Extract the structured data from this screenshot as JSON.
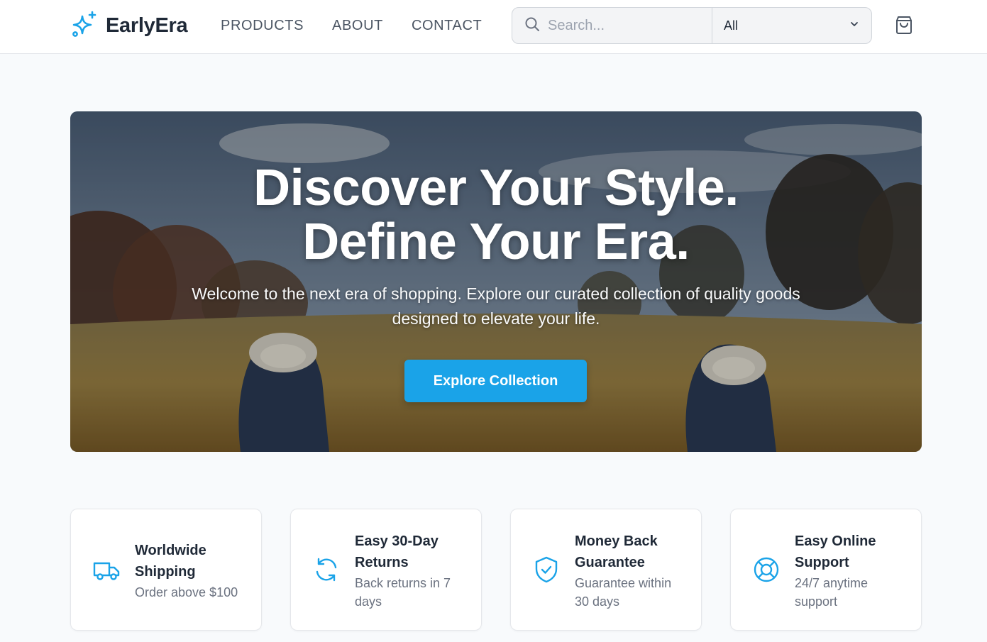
{
  "brand": {
    "name": "EarlyEra",
    "icon": "sparkles-icon",
    "accent": "#1aa3e8"
  },
  "nav": {
    "items": [
      {
        "label": "PRODUCTS"
      },
      {
        "label": "ABOUT"
      },
      {
        "label": "CONTACT"
      }
    ]
  },
  "search": {
    "placeholder": "Search...",
    "value": "",
    "category": "All",
    "icon": "search-icon"
  },
  "cart": {
    "icon": "shopping-bag-icon"
  },
  "hero": {
    "title_line1": "Discover Your Style.",
    "title_line2": "Define Your Era.",
    "subtitle": "Welcome to the next era of shopping. Explore our curated collection of quality goods designed to elevate your life.",
    "cta": "Explore Collection"
  },
  "features": [
    {
      "icon": "truck-icon",
      "title": "Worldwide Shipping",
      "subtitle": "Order above $100"
    },
    {
      "icon": "refresh-icon",
      "title": "Easy 30-Day Returns",
      "subtitle": "Back returns in 7 days"
    },
    {
      "icon": "shield-check-icon",
      "title": "Money Back Guarantee",
      "subtitle": "Guarantee within 30 days"
    },
    {
      "icon": "lifebuoy-icon",
      "title": "Easy Online Support",
      "subtitle": "24/7 anytime support"
    }
  ]
}
